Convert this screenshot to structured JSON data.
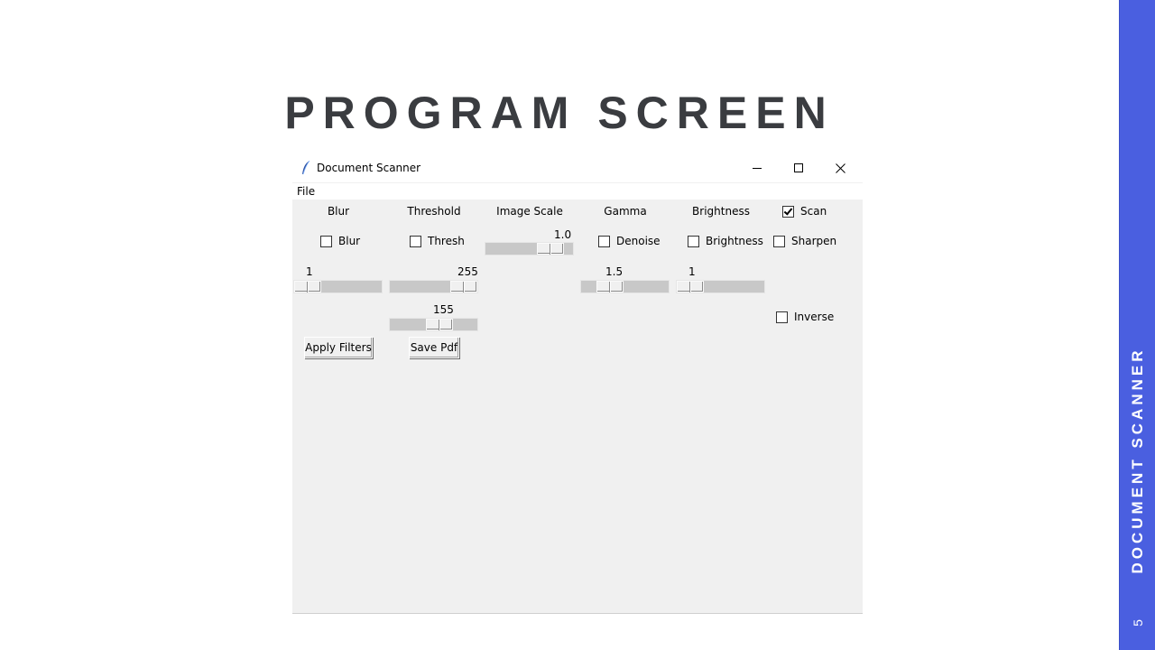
{
  "slide": {
    "title": "PROGRAM SCREEN",
    "side_label": "DOCUMENT SCANNER",
    "page_number": "5",
    "accent_color": "#4a5fe0"
  },
  "window": {
    "title": "Document Scanner",
    "icon": "feather-icon",
    "controls": [
      "minimize-icon",
      "maximize-icon",
      "close-icon"
    ]
  },
  "menu": {
    "file": "File"
  },
  "headers": {
    "blur": "Blur",
    "threshold": "Threshold",
    "image_scale": "Image Scale",
    "gamma": "Gamma",
    "brightness": "Brightness"
  },
  "checkboxes": {
    "scan": {
      "label": "Scan",
      "checked": true
    },
    "blur": {
      "label": "Blur",
      "checked": false
    },
    "thresh": {
      "label": "Thresh",
      "checked": false
    },
    "denoise": {
      "label": "Denoise",
      "checked": false
    },
    "brightness": {
      "label": "Brightness",
      "checked": false
    },
    "sharpen": {
      "label": "Sharpen",
      "checked": false
    },
    "inverse": {
      "label": "Inverse",
      "checked": false
    }
  },
  "sliders": {
    "image_scale": {
      "value": "1.0",
      "position": 0.85
    },
    "blur": {
      "value": "1",
      "position": 0.0
    },
    "threshold_max": {
      "value": "255",
      "position": 1.0
    },
    "gamma": {
      "value": "1.5",
      "position": 0.25
    },
    "brightness": {
      "value": "1",
      "position": 0.0
    },
    "threshold_min": {
      "value": "155",
      "position": 0.6
    }
  },
  "buttons": {
    "apply_filters": "Apply Filters",
    "save_pdf": "Save Pdf"
  }
}
